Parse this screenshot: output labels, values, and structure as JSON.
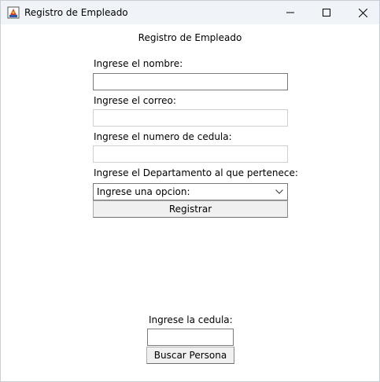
{
  "window": {
    "title": "Registro de Empleado"
  },
  "form": {
    "heading": "Registro de Empleado",
    "name_label": "Ingrese el nombre:",
    "name_value": "",
    "email_label": "Ingrese el correo:",
    "email_value": "",
    "id_label": "Ingrese el numero de cedula:",
    "id_value": "",
    "department_label": "Ingrese el Departamento al que pertenece:",
    "department_selected": "Ingrese una opcion:",
    "register_button": "Registrar"
  },
  "search": {
    "label": "Ingrese la cedula:",
    "value": "",
    "button": "Buscar Persona"
  },
  "icons": {
    "app": "java-app-icon",
    "minimize": "minimize-icon",
    "maximize": "maximize-icon",
    "close": "close-icon",
    "dropdown": "chevron-down-icon"
  },
  "colors": {
    "titlebar": "#f0f4f9",
    "button_face": "#f0f0f0",
    "field_border": "#7a7a7a"
  }
}
